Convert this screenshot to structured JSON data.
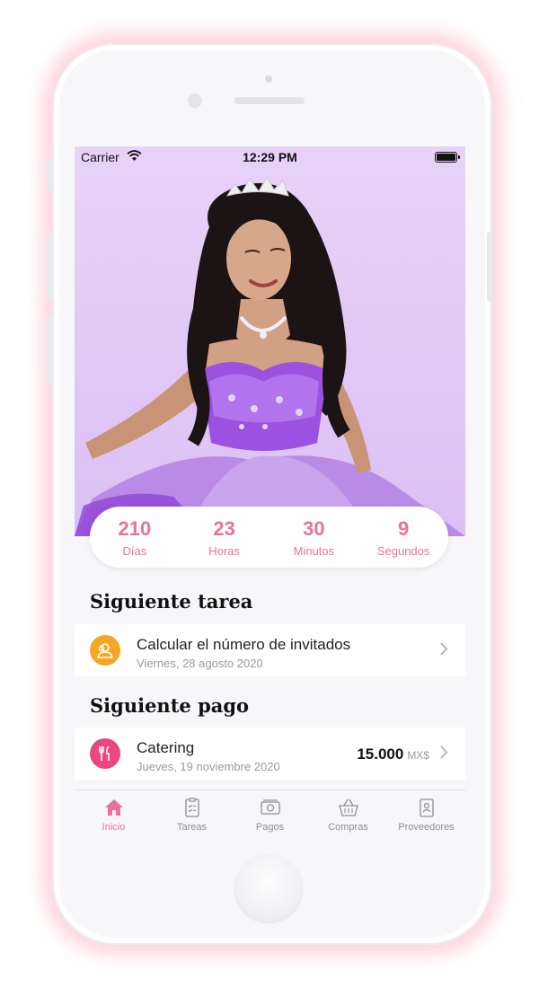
{
  "status_bar": {
    "carrier": "Carrier",
    "time": "12:29 PM"
  },
  "countdown": [
    {
      "value": "210",
      "label": "Días"
    },
    {
      "value": "23",
      "label": "Horas"
    },
    {
      "value": "30",
      "label": "Minutos"
    },
    {
      "value": "9",
      "label": "Segundos"
    }
  ],
  "next_task": {
    "section_title": "Siguiente tarea",
    "title": "Calcular el número de invitados",
    "date": "Viernes, 28 agosto 2020",
    "icon": "guests-icon",
    "icon_color": "#f5a623"
  },
  "next_payment": {
    "section_title": "Siguiente pago",
    "title": "Catering",
    "date": "Jueves, 19 noviembre 2020",
    "amount": "15.000",
    "currency": "MX$",
    "icon": "cutlery-icon",
    "icon_color": "#e8487f"
  },
  "tab_bar": [
    {
      "label": "Inicio",
      "icon": "home-icon",
      "active": true
    },
    {
      "label": "Tareas",
      "icon": "checklist-icon",
      "active": false
    },
    {
      "label": "Pagos",
      "icon": "money-icon",
      "active": false
    },
    {
      "label": "Compras",
      "icon": "basket-icon",
      "active": false
    },
    {
      "label": "Proveedores",
      "icon": "contacts-icon",
      "active": false
    }
  ],
  "colors": {
    "accent": "#e8739a",
    "hero_bg": "#dcc0f5"
  }
}
